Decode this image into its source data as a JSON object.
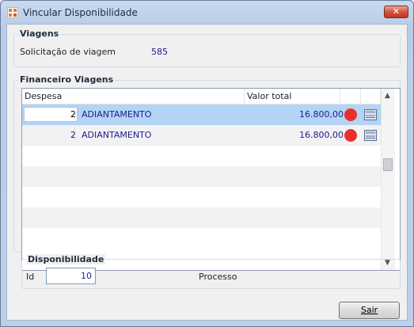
{
  "window": {
    "title": "Vincular Disponibilidade",
    "close_glyph": "✕"
  },
  "viagens": {
    "group_title": "Viagens",
    "solicitacao_label": "Solicitação de viagem",
    "solicitacao_value": "585"
  },
  "financeiro": {
    "group_title": "Financeiro Viagens",
    "columns": [
      "Despesa",
      "Valor total"
    ],
    "rows": [
      {
        "id": "2",
        "descricao": "ADIANTAMENTO",
        "valor": "16.800,00",
        "status_color": "#e8302a",
        "selected": true
      },
      {
        "id": "2",
        "descricao": "ADIANTAMENTO",
        "valor": "16.800,00",
        "status_color": "#e8302a",
        "selected": false
      }
    ],
    "empty_rows": 5
  },
  "disponibilidade": {
    "group_title": "Disponibilidade",
    "id_label": "Id",
    "id_value": "10",
    "processo_label": "Processo"
  },
  "footer": {
    "sair_label": "Sair"
  },
  "icons": {
    "app": "app-logo-icon",
    "status": "red-status-dot-icon",
    "document": "document-icon"
  }
}
